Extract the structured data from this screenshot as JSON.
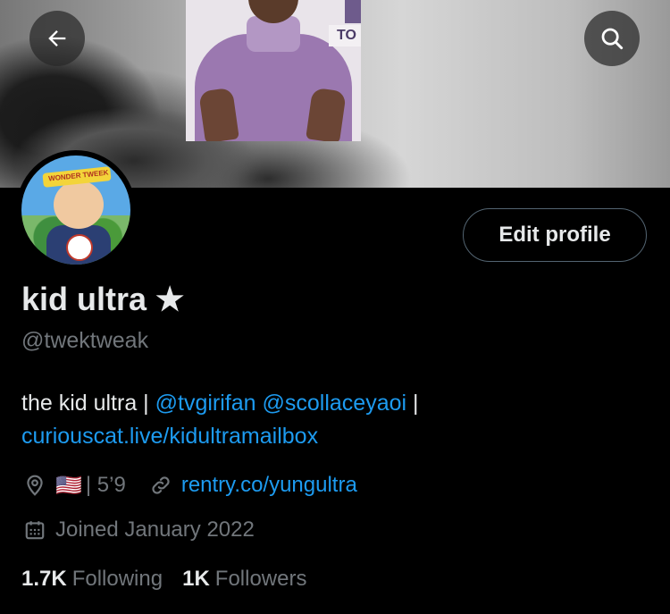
{
  "header": {
    "back_icon": "arrow-left-icon",
    "search_icon": "search-icon",
    "banner_sign_text": "TO"
  },
  "profile": {
    "display_name": "kid ultra ★",
    "handle": "@twektweak",
    "edit_button_label": "Edit profile",
    "avatar_band_text": "WONDER TWEEK",
    "bio": {
      "text_1": "the kid ultra | ",
      "mention_1": "@tvgirifan",
      "space": " ",
      "mention_2": "@scollaceyaoi",
      "text_2": " |",
      "link": "curiouscat.live/kidultramailbox"
    },
    "location": "| 5’9",
    "location_flag": "🇺🇸",
    "website": "rentry.co/yungultra",
    "joined": "Joined January 2022",
    "following_count": "1.7K",
    "following_label": "Following",
    "followers_count": "1K",
    "followers_label": "Followers"
  },
  "colors": {
    "background": "#000000",
    "primary_text": "#e7e9ea",
    "secondary_text": "#71767b",
    "link": "#1d9bf0",
    "border": "#536471"
  }
}
